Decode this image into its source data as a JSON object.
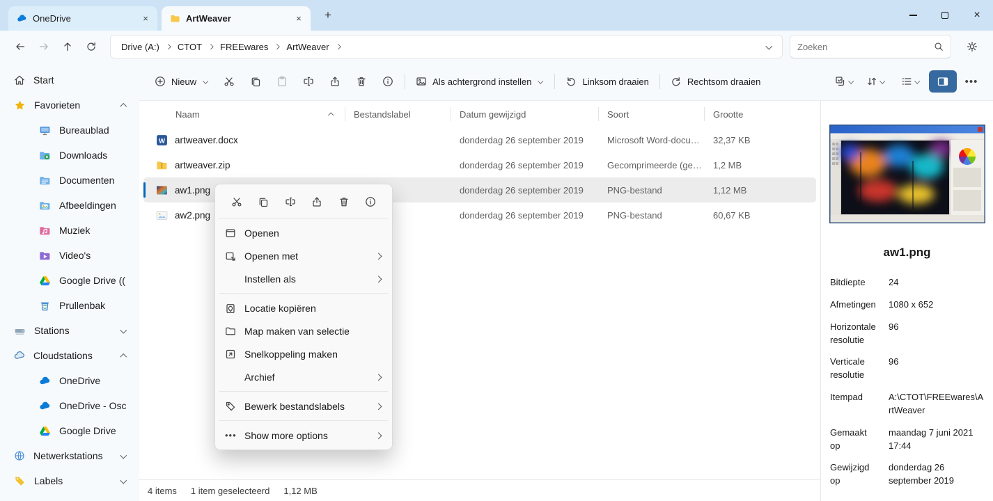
{
  "tabs": [
    {
      "label": "OneDrive"
    },
    {
      "label": "ArtWeaver"
    }
  ],
  "nav": {
    "breadcrumbs": [
      "Drive (A:)",
      "CTOT",
      "FREEwares",
      "ArtWeaver"
    ],
    "search_placeholder": "Zoeken"
  },
  "toolbar": {
    "new": "Nieuw",
    "set_background": "Als achtergrond instellen",
    "rotate_left": "Linksom draaien",
    "rotate_right": "Rechtsom draaien"
  },
  "sidebar": {
    "items": [
      {
        "label": "Start"
      },
      {
        "label": "Favorieten"
      },
      {
        "label": "Bureaublad"
      },
      {
        "label": "Downloads"
      },
      {
        "label": "Documenten"
      },
      {
        "label": "Afbeeldingen"
      },
      {
        "label": "Muziek"
      },
      {
        "label": "Video's"
      },
      {
        "label": "Google Drive (("
      },
      {
        "label": "Prullenbak"
      },
      {
        "label": "Stations"
      },
      {
        "label": "Cloudstations"
      },
      {
        "label": "OneDrive"
      },
      {
        "label": "OneDrive - Osc"
      },
      {
        "label": "Google Drive"
      },
      {
        "label": "Netwerkstations"
      },
      {
        "label": "Labels"
      }
    ]
  },
  "file_list": {
    "columns": [
      "Naam",
      "Bestandslabel",
      "Datum gewijzigd",
      "Soort",
      "Grootte"
    ],
    "rows": [
      {
        "name": "artweaver.docx",
        "modified": "donderdag 26 september 2019",
        "type": "Microsoft Word-docum...",
        "size": "32,37 KB"
      },
      {
        "name": "artweaver.zip",
        "modified": "donderdag 26 september 2019",
        "type": "Gecomprimeerde (gezi...",
        "size": "1,2 MB"
      },
      {
        "name": "aw1.png",
        "modified": "donderdag 26 september 2019",
        "type": "PNG-bestand",
        "size": "1,12 MB"
      },
      {
        "name": "aw2.png",
        "modified": "donderdag 26 september 2019",
        "type": "PNG-bestand",
        "size": "60,67 KB"
      }
    ]
  },
  "context_menu": {
    "items": [
      {
        "label": "Openen"
      },
      {
        "label": "Openen met"
      },
      {
        "label": "Instellen als"
      },
      {
        "label": "Locatie kopiëren"
      },
      {
        "label": "Map maken van selectie"
      },
      {
        "label": "Snelkoppeling maken"
      },
      {
        "label": "Archief"
      },
      {
        "label": "Bewerk bestandslabels"
      },
      {
        "label": "Show more options"
      }
    ]
  },
  "details_pane": {
    "title": "aw1.png",
    "properties": [
      {
        "label": "Bitdiepte",
        "value": "24"
      },
      {
        "label": "Afmetingen",
        "value": "1080 x 652"
      },
      {
        "label": "Horizontale resolutie",
        "value": "96"
      },
      {
        "label": "Verticale resolutie",
        "value": "96"
      },
      {
        "label": "Itempad",
        "value": "A:\\CTOT\\FREEwares\\ArtWeaver"
      },
      {
        "label": "Gemaakt op",
        "value": "maandag 7 juni 2021 17:44"
      },
      {
        "label": "Gewijzigd op",
        "value": "donderdag 26 september 2019"
      }
    ]
  },
  "status_bar": {
    "items_count": "4 items",
    "selected": "1 item geselecteerd",
    "size": "1,12 MB"
  }
}
